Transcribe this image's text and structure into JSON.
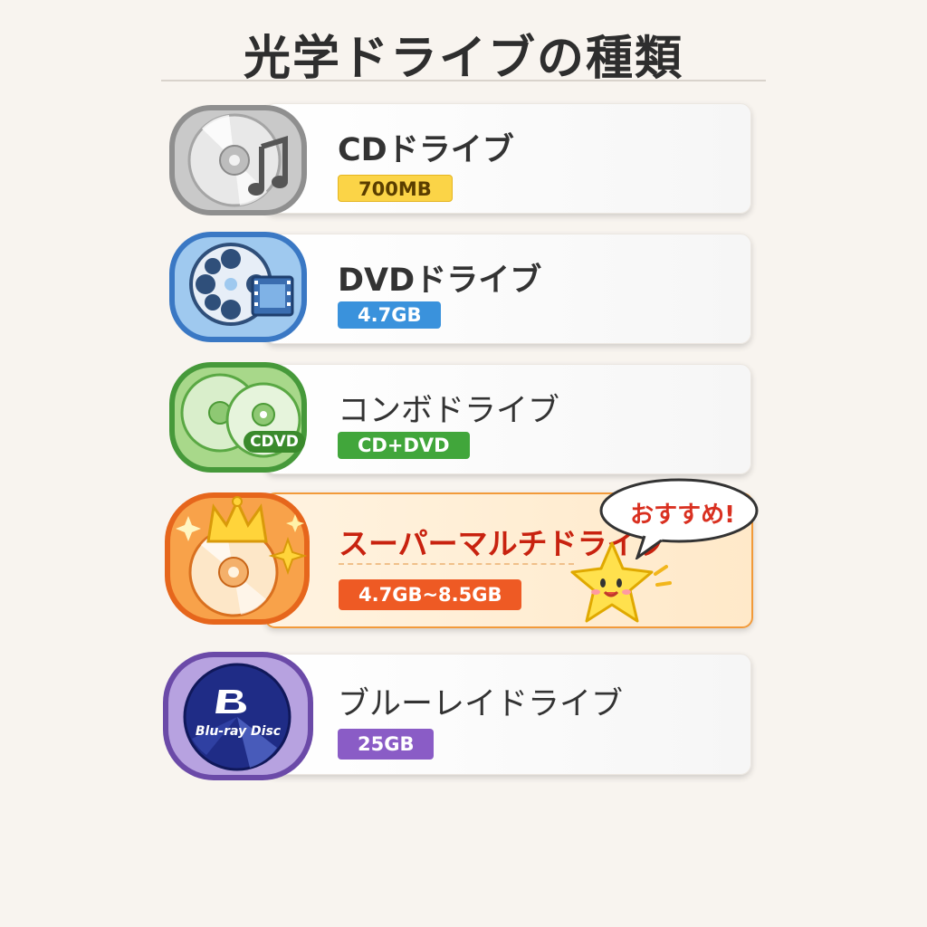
{
  "title": "光学ドライブの種類",
  "drives": [
    {
      "name": "CDドライブ",
      "capacity": "700MB",
      "icon": "cd-music-icon",
      "color": "#9a9a9a"
    },
    {
      "name": "DVDドライブ",
      "capacity": "4.7GB",
      "icon": "dvd-film-icon",
      "color": "#3f7fc8"
    },
    {
      "name": "コンボドライブ",
      "capacity": "CD+DVD",
      "icon": "combo-discs-icon",
      "color": "#4ea23e",
      "icon_label": "CDVD"
    },
    {
      "name": "スーパーマルチドライブ",
      "capacity": "4.7GB~8.5GB",
      "icon": "crown-disc-icon",
      "color": "#ef7a26"
    },
    {
      "name": "ブルーレイドライブ",
      "capacity": "25GB",
      "icon": "bluray-disc-icon",
      "color": "#7d5bbf",
      "icon_label": "Blu-ray Disc"
    }
  ],
  "recommend": {
    "text": "おすすめ!",
    "icon": "star-mascot-icon"
  }
}
